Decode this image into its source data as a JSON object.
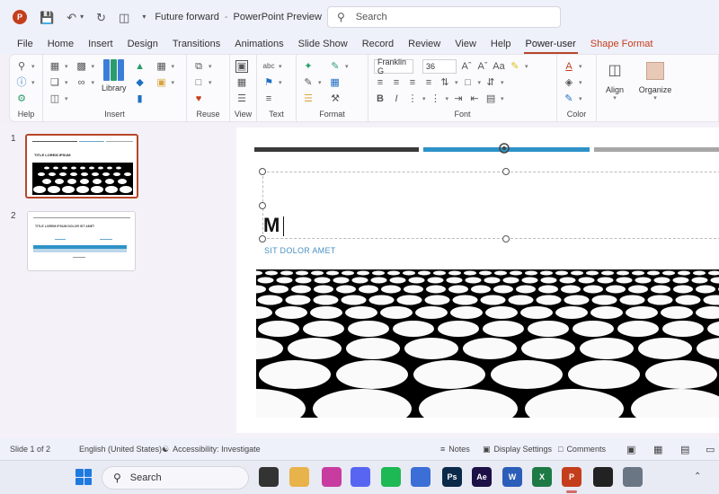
{
  "titlebar": {
    "app_logo": "P",
    "document_name": "Future forward",
    "app_name": "PowerPoint Preview",
    "search_placeholder": "Search"
  },
  "tabs": [
    "File",
    "Home",
    "Insert",
    "Design",
    "Transitions",
    "Animations",
    "Slide Show",
    "Record",
    "Review",
    "View",
    "Help",
    "Power-user",
    "Shape Format"
  ],
  "active_tab": "Power-user",
  "ribbon": {
    "groups": {
      "help": "Help",
      "insert": "Insert",
      "reuse": "Reuse",
      "view": "View",
      "text": "Text",
      "format": "Format",
      "font": "Font",
      "color": "Color"
    },
    "library_label": "Library",
    "font_name": "Franklin G",
    "font_size": "36",
    "align_label": "Align",
    "organize_label": "Organize",
    "bold": "B",
    "italic": "I"
  },
  "slides_pane": {
    "slides": [
      {
        "number": "1",
        "title": "TITLE LOREM IPSUM"
      },
      {
        "number": "2",
        "title": "TITLE LOREM IPSUM DOLOR SIT AMET"
      }
    ]
  },
  "slide": {
    "title_text": "M",
    "subtitle": "SIT DOLOR AMET",
    "bar_colors": [
      "#3a3a3a",
      "#2e92c8",
      "#a7a7a7"
    ]
  },
  "statusbar": {
    "slide_position": "Slide 1 of 2",
    "language": "English (United States)",
    "accessibility": "Accessibility: Investigate",
    "notes": "Notes",
    "display_settings": "Display Settings",
    "comments": "Comments"
  },
  "taskbar": {
    "search_placeholder": "Search",
    "apps": [
      {
        "name": "task-view",
        "label": "",
        "color": "#333"
      },
      {
        "name": "file-explorer",
        "label": "",
        "color": "#e8b34a"
      },
      {
        "name": "visual-studio",
        "label": "",
        "color": "#c83ca0"
      },
      {
        "name": "discord",
        "label": "",
        "color": "#5865f2"
      },
      {
        "name": "spotify",
        "label": "",
        "color": "#1db954"
      },
      {
        "name": "notepad",
        "label": "",
        "color": "#3b6ed6"
      },
      {
        "name": "photoshop",
        "label": "Ps",
        "color": "#0b2a4a"
      },
      {
        "name": "after-effects",
        "label": "Ae",
        "color": "#1c1046"
      },
      {
        "name": "word",
        "label": "W",
        "color": "#2b5eb8"
      },
      {
        "name": "excel",
        "label": "X",
        "color": "#1d7a45"
      },
      {
        "name": "powerpoint",
        "label": "P",
        "color": "#c43e1c"
      },
      {
        "name": "github-copilot",
        "label": "",
        "color": "#222"
      },
      {
        "name": "settings",
        "label": "",
        "color": "#6b7685"
      }
    ]
  }
}
